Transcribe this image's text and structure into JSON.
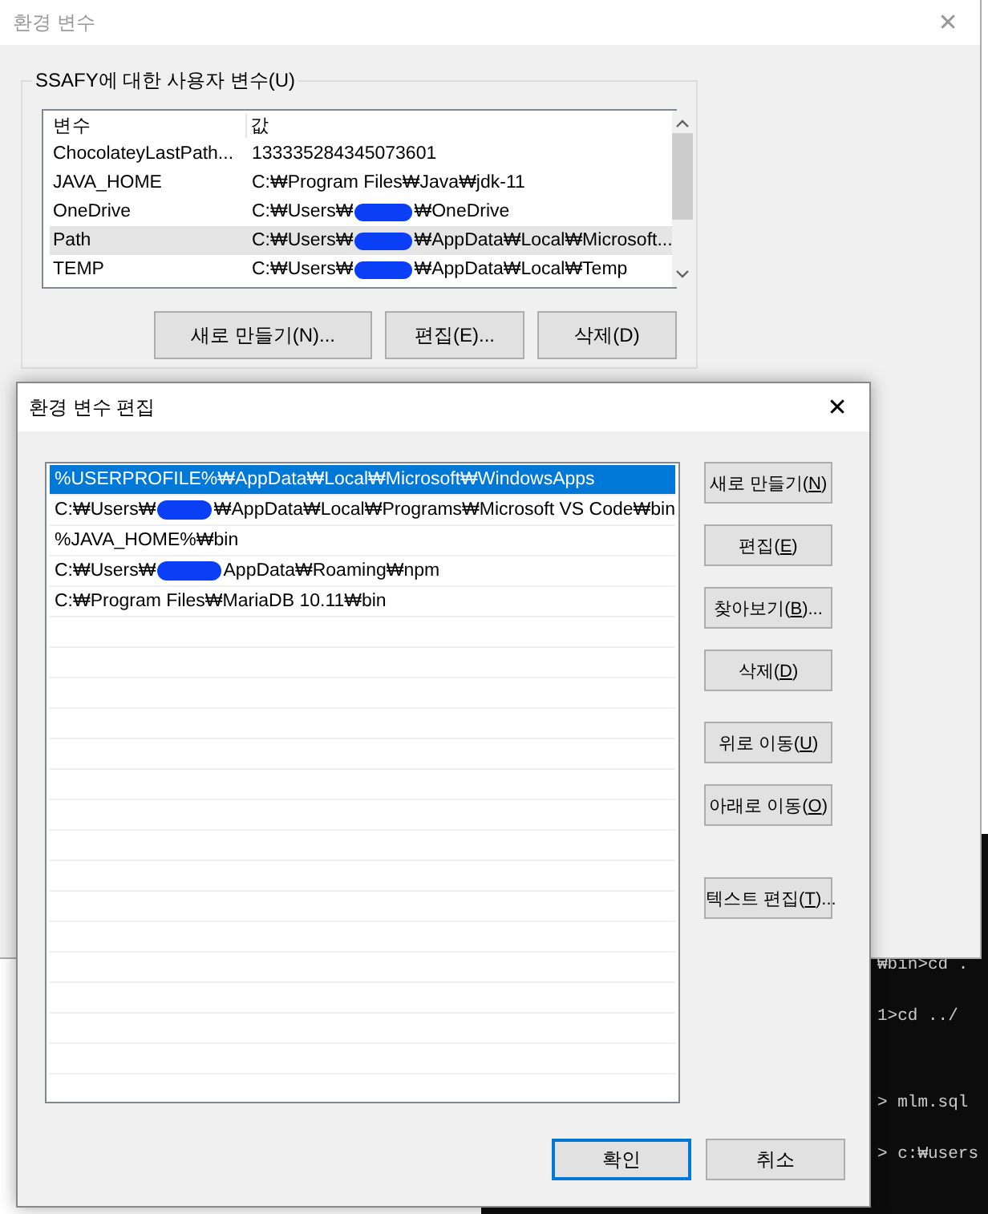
{
  "back_window": {
    "title": "환경 변수",
    "close": "✕",
    "group_label": "SSAFY에 대한 사용자 변수(U)",
    "columns": [
      "변수",
      "값"
    ],
    "rows": [
      {
        "name": "ChocolateyLastPath...",
        "before": "133335284345073601",
        "redacted": false,
        "selected": false
      },
      {
        "name": "JAVA_HOME",
        "before": "C:₩Program Files₩Java₩jdk-11",
        "redacted": false,
        "selected": false
      },
      {
        "name": "OneDrive",
        "before": "C:₩Users₩",
        "redacted": true,
        "after": "₩OneDrive",
        "selected": false
      },
      {
        "name": "Path",
        "before": "C:₩Users₩",
        "redacted": true,
        "after": "₩AppData₩Local₩Microsoft...",
        "selected": true
      },
      {
        "name": "TEMP",
        "before": "C:₩Users₩",
        "redacted": true,
        "after": "₩AppData₩Local₩Temp",
        "selected": false
      }
    ],
    "buttons": [
      "새로 만들기(N)...",
      "편집(E)...",
      "삭제(D)"
    ]
  },
  "edit_dialog": {
    "title": "환경 변수 편집",
    "close": "✕",
    "entries": [
      {
        "before": "%USERPROFILE%₩AppData₩Local₩Microsoft₩WindowsApps",
        "redacted": false,
        "selected": true
      },
      {
        "before": "C:₩Users₩",
        "redacted": true,
        "after": "₩AppData₩Local₩Programs₩Microsoft VS Code₩bin",
        "selected": false
      },
      {
        "before": "%JAVA_HOME%₩bin",
        "redacted": false,
        "selected": false
      },
      {
        "before": "C:₩Users₩",
        "redacted": true,
        "after": "AppData₩Roaming₩npm",
        "selected": false
      },
      {
        "before": "C:₩Program Files₩MariaDB 10.11₩bin",
        "redacted": false,
        "selected": false
      }
    ],
    "side_button_groups": [
      [
        {
          "pre": "새로 만들기(",
          "key": "N",
          "post": ")"
        },
        {
          "pre": "편집(",
          "key": "E",
          "post": ")"
        },
        {
          "pre": "찾아보기(",
          "key": "B",
          "post": ")..."
        },
        {
          "pre": "삭제(",
          "key": "D",
          "post": ")"
        }
      ],
      [
        {
          "pre": "위로 이동(",
          "key": "U",
          "post": ")"
        },
        {
          "pre": "아래로 이동(",
          "key": "O",
          "post": ")"
        }
      ],
      [
        {
          "pre": "텍스트 편집(",
          "key": "T",
          "post": ")..."
        }
      ]
    ],
    "ok": {
      "label": "확인",
      "default": true
    },
    "cancel": {
      "label": "취소",
      "default": false
    }
  },
  "terminal": {
    "lines": [
      "₩bin>cd .",
      "1>cd ../",
      "> mlm.sql",
      "> c:₩users"
    ]
  }
}
